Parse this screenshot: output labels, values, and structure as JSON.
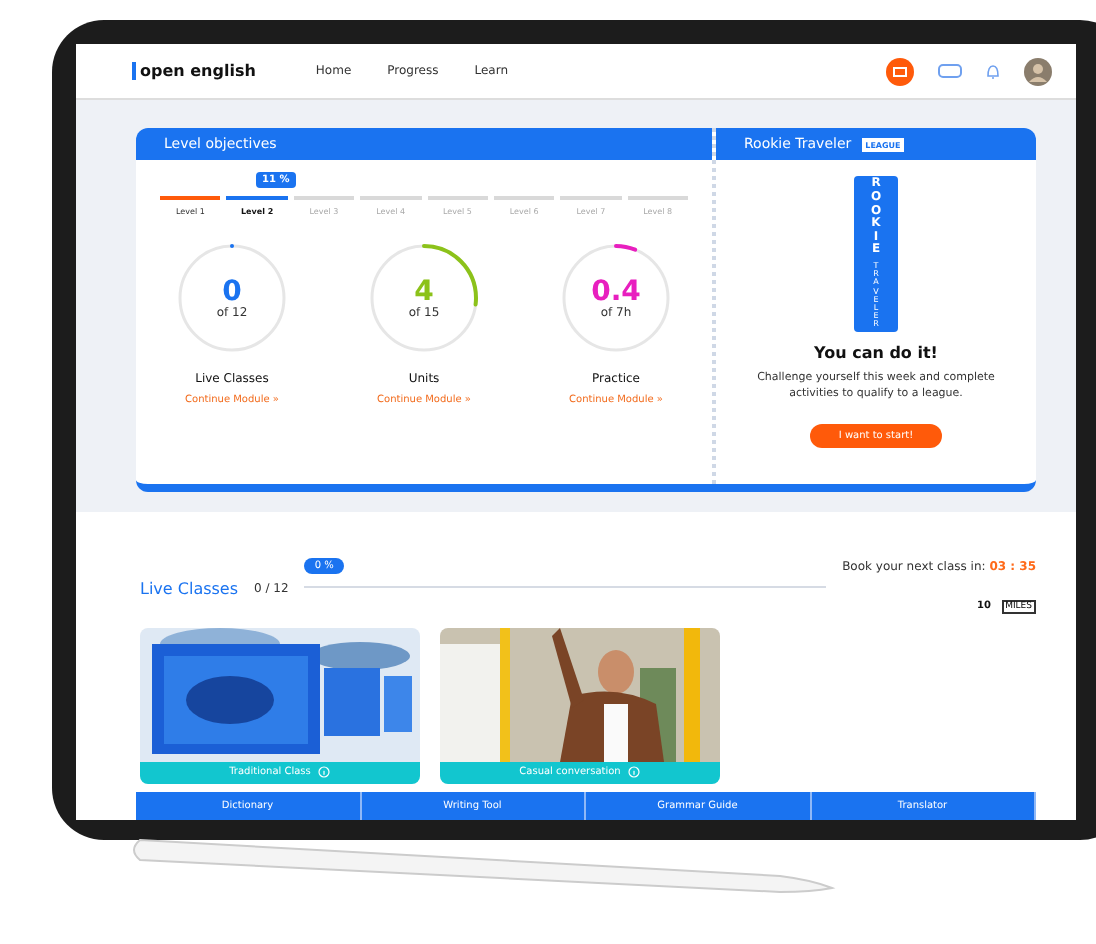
{
  "nav": {
    "logo": "open english",
    "links": [
      "Home",
      "Progress",
      "Learn"
    ]
  },
  "objectives": {
    "title": "Level objectives",
    "badge": "11 %",
    "levels": [
      {
        "label": "Level 1",
        "completed": true,
        "selected": false
      },
      {
        "label": "Level 2",
        "completed": false,
        "selected": true
      },
      {
        "label": "Level 3",
        "completed": false,
        "selected": false
      },
      {
        "label": "Level 4",
        "completed": false,
        "selected": false
      },
      {
        "label": "Level 5",
        "completed": false,
        "selected": false
      },
      {
        "label": "Level 6",
        "completed": false,
        "selected": false
      },
      {
        "label": "Level 7",
        "completed": false,
        "selected": false
      },
      {
        "label": "Level 8",
        "completed": false,
        "selected": false
      }
    ],
    "stats": [
      {
        "value": "0",
        "of": "of 12",
        "title": "Live Classes",
        "link": "Continue Module »",
        "color": "#1a73f0",
        "level": 0
      },
      {
        "value": "4",
        "of": "of 15",
        "title": "Units",
        "link": "Continue Module »",
        "color": "#8cc21a",
        "level": 0.27
      },
      {
        "value": "0.4",
        "of": "of 7h",
        "title": "Practice",
        "link": "Continue Module »",
        "color": "#e81fbf",
        "level": 0.06
      }
    ]
  },
  "league": {
    "title": "Rookie Traveler",
    "badge": "LEAGUE",
    "emblem": "ROOKIE",
    "emblem_sub": "TRAVELER",
    "heading": "You can do it!",
    "text": "Challenge yourself this week and complete activities to qualify to a league.",
    "button": "I want to start!"
  },
  "live": {
    "title": "Live Classes",
    "count": "0 / 12",
    "badge": "0 %",
    "level": 0,
    "book": "Book your next class in:",
    "timer": "03 : 35",
    "miles": "10",
    "miles_tag": "MILES",
    "classes": [
      {
        "caption": "Traditional Class",
        "kind": "screens"
      },
      {
        "caption": "Casual conversation",
        "kind": "bus"
      }
    ]
  },
  "tools": [
    "Dictionary",
    "Writing Tool",
    "Grammar Guide",
    "Translator"
  ]
}
